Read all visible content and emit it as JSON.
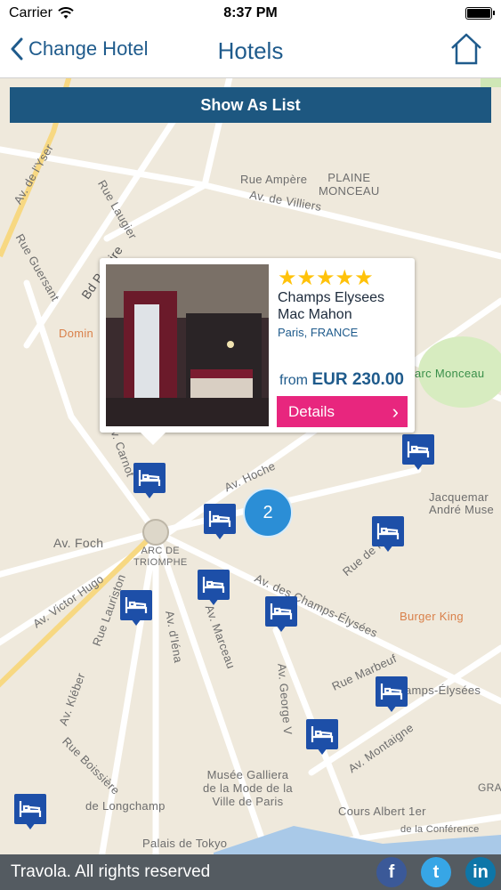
{
  "status_bar": {
    "carrier": "Carrier",
    "time": "8:37 PM"
  },
  "nav": {
    "back_label": "Change Hotel",
    "title": "Hotels"
  },
  "show_list_label": "Show As List",
  "callout": {
    "stars": "★★★★★",
    "hotel_name": "Champs Elysees Mac Mahon",
    "location": "Paris, FRANCE",
    "price_prefix": "from",
    "price": "EUR 230.00",
    "details_label": "Details"
  },
  "cluster_count": "2",
  "map_labels": {
    "plaine_monceau": "PLAINE\nMONCEAU",
    "rue_ampere": "Rue Ampère",
    "av_villiers": "Av. de Villiers",
    "bd_pereire": "Bd Pereire",
    "rue_laugier": "Rue Laugier",
    "rue_guersant": "Rue Guersant",
    "av_yser": "Av. de l'Yser",
    "domin": "Domin",
    "parc_monceau": "arc Monceau",
    "av_hoche": "Av. Hoche",
    "av_foch": "Av. Foch",
    "arc": "ARC DE\nTRIOMPHE",
    "av_victor_hugo": "Av. Victor Hugo",
    "av_iena": "Av. d'Iéna",
    "av_marceau": "Av. Marceau",
    "champs": "Av. des Champs-Élysées",
    "burger_king": "Burger King",
    "jacquemart": "Jacquemar\nAndré Muse",
    "av_george_v": "Av. George V",
    "rue_marbeuf": "Rue Marbeuf",
    "av_montaigne": "Av. Montaigne",
    "musee_galliera": "Musée Galliera\nde la Mode de la\nVille de Paris",
    "longchamp": "de Longchamp",
    "palais_tokyo": "Palais de Tokyo",
    "cours_albert": "Cours Albert 1er",
    "conference": "de la Conférence",
    "av_kleber": "Av. Kléber",
    "rue_boissiere": "Rue Boissière",
    "champs_elysees_station": "amps-Élysées",
    "rue_de_la_boetie": "Rue de la",
    "av_carnot": "Av. Carnot",
    "rue_lauriston": "Rue Lauriston",
    "gra": "GRA"
  },
  "footer": {
    "text": "Travola. All rights reserved",
    "facebook": "f",
    "twitter": "t",
    "linkedin": "in"
  },
  "colors": {
    "navy": "#1d5780",
    "pink": "#e8267e",
    "pin": "#1d4fa8",
    "cluster": "#2b8ed6",
    "star": "#ffc20a"
  }
}
